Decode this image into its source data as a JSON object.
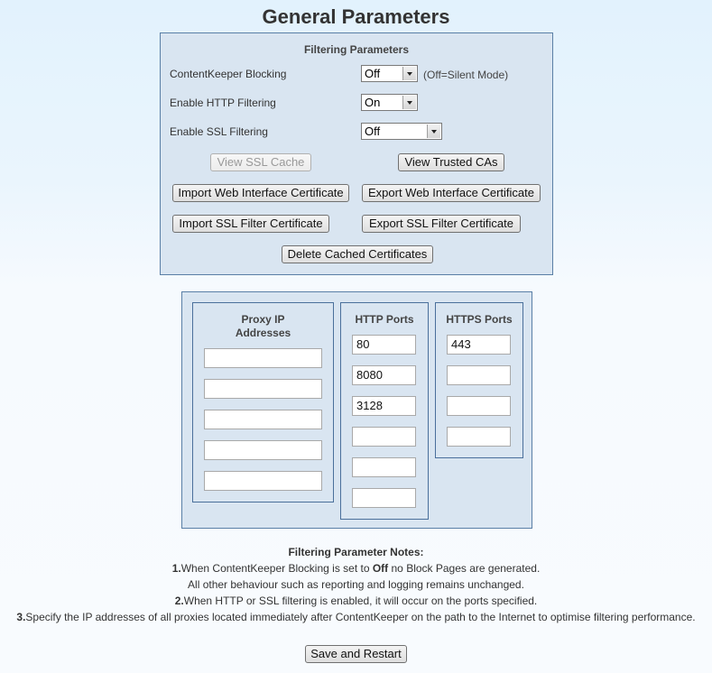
{
  "page": {
    "title": "General Parameters"
  },
  "filtering": {
    "heading": "Filtering Parameters",
    "rows": [
      {
        "label": "ContentKeeper Blocking",
        "value": "Off",
        "hint": "(Off=Silent Mode)"
      },
      {
        "label": "Enable HTTP Filtering",
        "value": "On",
        "hint": ""
      },
      {
        "label": "Enable SSL Filtering",
        "value": "Off",
        "hint": ""
      }
    ],
    "buttons": {
      "view_ssl_cache": "View SSL Cache",
      "view_trusted_cas": "View Trusted CAs",
      "import_web_cert": "Import Web Interface Certificate",
      "export_web_cert": "Export Web Interface Certificate",
      "import_ssl_cert": "Import SSL Filter Certificate",
      "export_ssl_cert": "Export SSL Filter Certificate",
      "delete_cached": "Delete Cached Certificates"
    }
  },
  "ports": {
    "proxy": {
      "heading_line1": "Proxy IP",
      "heading_line2": "Addresses",
      "values": [
        "",
        "",
        "",
        "",
        ""
      ]
    },
    "http": {
      "heading": "HTTP Ports",
      "values": [
        "80",
        "8080",
        "3128",
        "",
        "",
        ""
      ]
    },
    "https": {
      "heading": "HTTPS Ports",
      "values": [
        "443",
        "",
        "",
        ""
      ]
    }
  },
  "notes": {
    "heading": "Filtering Parameter Notes:",
    "n1_num": "1.",
    "n1_a": "When ContentKeeper Blocking is set to ",
    "n1_bold": "Off",
    "n1_b": " no Block Pages are generated.",
    "n1_line2": "All other behaviour such as reporting and logging remains unchanged.",
    "n2_num": "2.",
    "n2": "When HTTP or SSL filtering is enabled, it will occur on the ports specified.",
    "n3_num": "3.",
    "n3": "Specify the IP addresses of all proxies located immediately after ContentKeeper on the path to the Internet to optimise filtering performance."
  },
  "save_button": "Save and Restart"
}
